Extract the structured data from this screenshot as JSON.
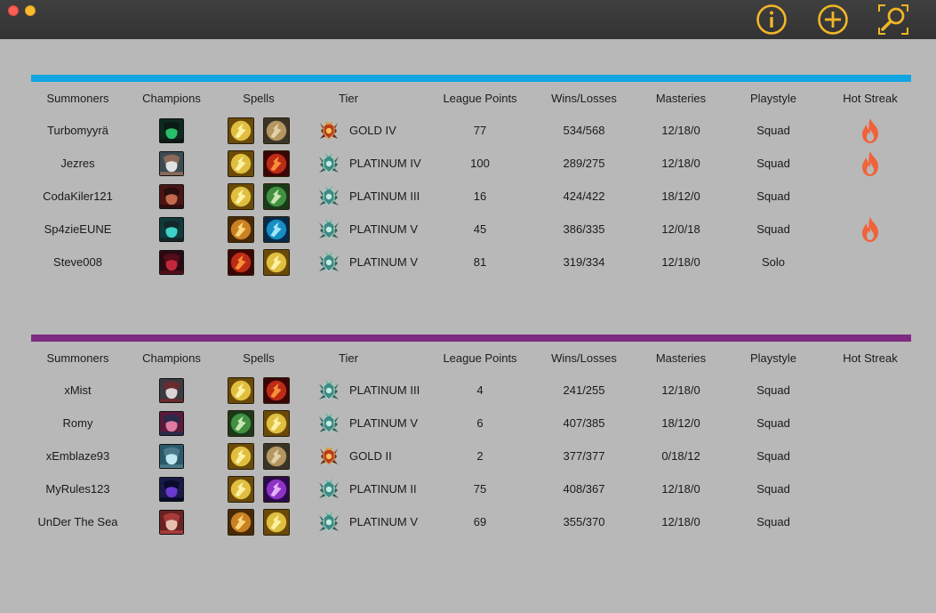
{
  "colors": {
    "window_bg": "#b8b8b8",
    "titlebar": "#383838",
    "toolbar_icon": "#f2b627",
    "team1_bar": "#12a5e3",
    "team2_bar": "#7e2a82",
    "hot_streak": "#f0623a"
  },
  "toolbar": {
    "icons": [
      "info-icon",
      "add-icon",
      "search-icon"
    ]
  },
  "columns": {
    "summoners": "Summoners",
    "champions": "Champions",
    "spells": "Spells",
    "tier": "Tier",
    "league_points": "League Points",
    "wins_losses": "Wins/Losses",
    "masteries": "Masteries",
    "playstyle": "Playstyle",
    "hot_streak": "Hot Streak"
  },
  "teams": [
    {
      "players": [
        {
          "summoner": "Turbomyyrä",
          "champion_icon": "green-champion-portrait",
          "spells": [
            "flash-spell-icon",
            "exhaust-spell-icon"
          ],
          "tier_icon": "gold-tier-icon",
          "tier": "GOLD IV",
          "lp": "77",
          "wl": "534/568",
          "masteries": "12/18/0",
          "playstyle": "Squad",
          "hot_streak": true
        },
        {
          "summoner": "Jezres",
          "champion_icon": "white-haired-champion-portrait",
          "spells": [
            "flash-spell-icon",
            "ignite-spell-icon"
          ],
          "tier_icon": "platinum-tier-icon",
          "tier": "PLATINUM IV",
          "lp": "100",
          "wl": "289/275",
          "masteries": "12/18/0",
          "playstyle": "Squad",
          "hot_streak": true
        },
        {
          "summoner": "CodaKiler121",
          "champion_icon": "red-champion-portrait",
          "spells": [
            "flash-spell-icon",
            "teleport-spell-icon"
          ],
          "tier_icon": "platinum-tier-icon",
          "tier": "PLATINUM III",
          "lp": "16",
          "wl": "424/422",
          "masteries": "18/12/0",
          "playstyle": "Squad",
          "hot_streak": false
        },
        {
          "summoner": "Sp4zieEUNE",
          "champion_icon": "teal-champion-portrait",
          "spells": [
            "smite-spell-icon",
            "ghost-spell-icon"
          ],
          "tier_icon": "platinum-tier-icon",
          "tier": "PLATINUM V",
          "lp": "45",
          "wl": "386/335",
          "masteries": "12/0/18",
          "playstyle": "Squad",
          "hot_streak": true
        },
        {
          "summoner": "Steve008",
          "champion_icon": "crimson-champion-portrait",
          "spells": [
            "ignite-spell-icon",
            "flash-spell-icon"
          ],
          "tier_icon": "platinum-tier-icon",
          "tier": "PLATINUM V",
          "lp": "81",
          "wl": "319/334",
          "masteries": "12/18/0",
          "playstyle": "Solo",
          "hot_streak": false
        }
      ]
    },
    {
      "players": [
        {
          "summoner": "xMist",
          "champion_icon": "grey-champion-portrait",
          "spells": [
            "flash-spell-icon",
            "ignite-spell-icon"
          ],
          "tier_icon": "platinum-tier-icon",
          "tier": "PLATINUM III",
          "lp": "4",
          "wl": "241/255",
          "masteries": "12/18/0",
          "playstyle": "Squad",
          "hot_streak": false
        },
        {
          "summoner": "Romy",
          "champion_icon": "pink-champion-portrait",
          "spells": [
            "teleport-spell-icon",
            "flash-spell-icon"
          ],
          "tier_icon": "platinum-tier-icon",
          "tier": "PLATINUM V",
          "lp": "6",
          "wl": "407/385",
          "masteries": "18/12/0",
          "playstyle": "Squad",
          "hot_streak": false
        },
        {
          "summoner": "xEmblaze93",
          "champion_icon": "cyan-champion-portrait",
          "spells": [
            "flash-spell-icon",
            "exhaust-spell-icon"
          ],
          "tier_icon": "gold-tier-icon",
          "tier": "GOLD II",
          "lp": "2",
          "wl": "377/377",
          "masteries": "0/18/12",
          "playstyle": "Squad",
          "hot_streak": false
        },
        {
          "summoner": "MyRules123",
          "champion_icon": "violet-champion-portrait",
          "spells": [
            "flash-spell-icon",
            "cleanse-spell-icon"
          ],
          "tier_icon": "platinum-tier-icon",
          "tier": "PLATINUM II",
          "lp": "75",
          "wl": "408/367",
          "masteries": "12/18/0",
          "playstyle": "Squad",
          "hot_streak": false
        },
        {
          "summoner": "UnDer The Sea",
          "champion_icon": "rose-champion-portrait",
          "spells": [
            "smite-spell-icon",
            "flash-spell-icon"
          ],
          "tier_icon": "platinum-tier-icon",
          "tier": "PLATINUM V",
          "lp": "69",
          "wl": "355/370",
          "masteries": "12/18/0",
          "playstyle": "Squad",
          "hot_streak": false
        }
      ]
    }
  ]
}
